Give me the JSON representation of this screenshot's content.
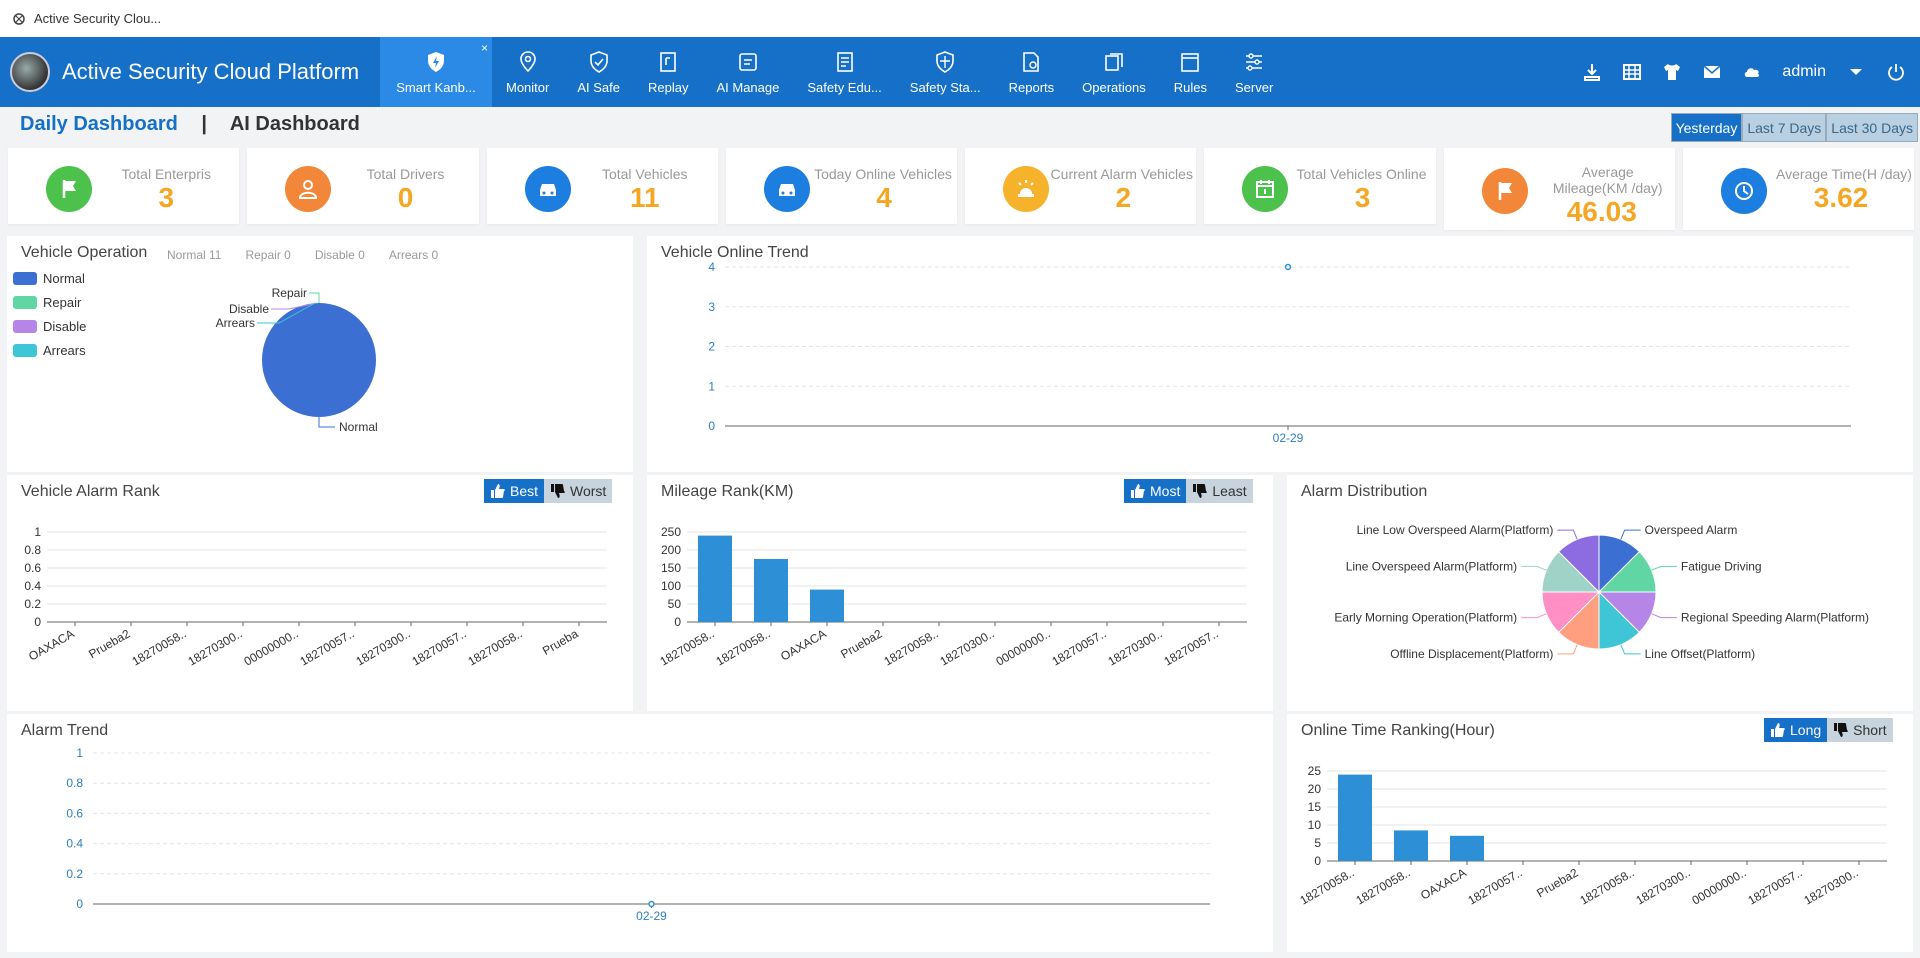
{
  "window": {
    "title": "Active Security Clou..."
  },
  "brand": {
    "name": "Active Security Cloud Platform"
  },
  "nav": {
    "items": [
      {
        "label": "Smart Kanb...",
        "icon": "shield-bolt-icon"
      },
      {
        "label": "Monitor",
        "icon": "location-pin-icon"
      },
      {
        "label": "AI Safe",
        "icon": "shield-check-icon"
      },
      {
        "label": "Replay",
        "icon": "replay-icon"
      },
      {
        "label": "AI Manage",
        "icon": "manage-icon"
      },
      {
        "label": "Safety Edu...",
        "icon": "book-icon"
      },
      {
        "label": "Safety Sta...",
        "icon": "station-icon"
      },
      {
        "label": "Reports",
        "icon": "report-icon"
      },
      {
        "label": "Operations",
        "icon": "operations-icon"
      },
      {
        "label": "Rules",
        "icon": "rules-icon"
      },
      {
        "label": "Server",
        "icon": "server-icon"
      }
    ],
    "close_glyph": "×",
    "user": "admin"
  },
  "header": {
    "daily": "Daily Dashboard",
    "separator": "|",
    "ai": "AI Dashboard",
    "ranges": [
      "Yesterday",
      "Last 7 Days",
      "Last 30 Days"
    ]
  },
  "stats": [
    {
      "label": "Total Enterpris",
      "value": "3",
      "color": "#4cc14c",
      "icon": "flag-icon"
    },
    {
      "label": "Total Drivers",
      "value": "0",
      "color": "#f2873a",
      "icon": "driver-icon"
    },
    {
      "label": "Total Vehicles",
      "value": "11",
      "color": "#1c7fe0",
      "icon": "car-icon"
    },
    {
      "label": "Today Online Vehicles",
      "value": "4",
      "color": "#1c7fe0",
      "icon": "car-icon"
    },
    {
      "label": "Current Alarm Vehicles",
      "value": "2",
      "color": "#f5b22a",
      "icon": "alarm-icon"
    },
    {
      "label": "Total Vehicles Online",
      "value": "3",
      "color": "#4cc14c",
      "icon": "calendar-icon"
    },
    {
      "label": "Average Mileage(KM /day)",
      "value": "46.03",
      "color": "#f2873a",
      "icon": "flag-icon"
    },
    {
      "label": "Average Time(H /day)",
      "value": "3.62",
      "color": "#1c7fe0",
      "icon": "clock-icon"
    }
  ],
  "vehicle_operation": {
    "title": "Vehicle Operation",
    "summary": [
      "Normal 11",
      "Repair 0",
      "Disable 0",
      "Arrears 0"
    ],
    "legend": [
      {
        "label": "Normal",
        "color": "#3b6fd1"
      },
      {
        "label": "Repair",
        "color": "#5fd6a4"
      },
      {
        "label": "Disable",
        "color": "#b585e8"
      },
      {
        "label": "Arrears",
        "color": "#3fc6d6"
      }
    ]
  },
  "online_trend": {
    "title": "Vehicle Online Trend"
  },
  "alarm_rank": {
    "title": "Vehicle Alarm Rank",
    "best": "Best",
    "worst": "Worst"
  },
  "mileage_rank": {
    "title": "Mileage Rank(KM)",
    "most": "Most",
    "least": "Least"
  },
  "alarm_dist": {
    "title": "Alarm Distribution"
  },
  "alarm_trend": {
    "title": "Alarm Trend"
  },
  "online_time": {
    "title": "Online Time Ranking(Hour)",
    "long": "Long",
    "short": "Short"
  },
  "chart_data": [
    {
      "id": "vehicle-operation",
      "type": "pie",
      "labels": [
        "Normal",
        "Repair",
        "Disable",
        "Arrears"
      ],
      "values": [
        11,
        0,
        0,
        0
      ],
      "colors": [
        "#3b6fd1",
        "#5fd6a4",
        "#b585e8",
        "#3fc6d6"
      ]
    },
    {
      "id": "online-trend",
      "type": "line",
      "x": [
        "02-29"
      ],
      "values": [
        4
      ],
      "ylim": [
        0,
        4
      ],
      "yticks": [
        0,
        1,
        2,
        3,
        4
      ],
      "grid": true
    },
    {
      "id": "alarm-rank",
      "type": "bar",
      "categories": [
        "OAXACA",
        "Prueba2",
        "18270058..",
        "18270300..",
        "00000000..",
        "18270057..",
        "18270300..",
        "18270057..",
        "18270058..",
        "Prueba"
      ],
      "values": [
        0,
        0,
        0,
        0,
        0,
        0,
        0,
        0,
        0,
        0
      ],
      "ylim": [
        0,
        1
      ],
      "yticks": [
        "0",
        "0.2",
        "0.4",
        "0.6",
        "0.8",
        "1"
      ]
    },
    {
      "id": "mileage-rank",
      "type": "bar",
      "categories": [
        "18270058..",
        "18270058..",
        "OAXACA",
        "Prueba2",
        "18270058..",
        "18270300..",
        "00000000..",
        "18270057..",
        "18270300..",
        "18270057.."
      ],
      "values": [
        240,
        175,
        90,
        0,
        0,
        0,
        0,
        0,
        0,
        0
      ],
      "ylim": [
        0,
        250
      ],
      "yticks": [
        "0",
        "50",
        "100",
        "150",
        "200",
        "250"
      ]
    },
    {
      "id": "alarm-distribution",
      "type": "pie",
      "labels": [
        "Overspeed Alarm",
        "Fatigue Driving",
        "Regional Speeding Alarm(Platform)",
        "Line Offset(Platform)",
        "Offline Displacement(Platform)",
        "Early Morning Operation(Platform)",
        "Line Overspeed Alarm(Platform)",
        "Line Low Overspeed Alarm(Platform)"
      ],
      "values": [
        1,
        1,
        1,
        1,
        1,
        1,
        1,
        1
      ],
      "colors": [
        "#3b6fd1",
        "#5fd6a4",
        "#b585e8",
        "#3fc6d6",
        "#ff9f80",
        "#ff8fc4",
        "#9fd3c7",
        "#8d6be0"
      ]
    },
    {
      "id": "alarm-trend",
      "type": "line",
      "x": [
        "02-29"
      ],
      "values": [
        0
      ],
      "ylim": [
        0,
        1
      ],
      "yticks": [
        "0",
        "0.2",
        "0.4",
        "0.6",
        "0.8",
        "1"
      ],
      "grid": true
    },
    {
      "id": "online-time",
      "type": "bar",
      "categories": [
        "18270058..",
        "18270058..",
        "OAXACA",
        "18270057..",
        "Prueba2",
        "18270058..",
        "18270300..",
        "00000000..",
        "18270057..",
        "18270300.."
      ],
      "values": [
        24,
        8.5,
        7,
        0,
        0,
        0,
        0,
        0,
        0,
        0
      ],
      "ylim": [
        0,
        25
      ],
      "yticks": [
        "0",
        "5",
        "10",
        "15",
        "20",
        "25"
      ]
    }
  ]
}
